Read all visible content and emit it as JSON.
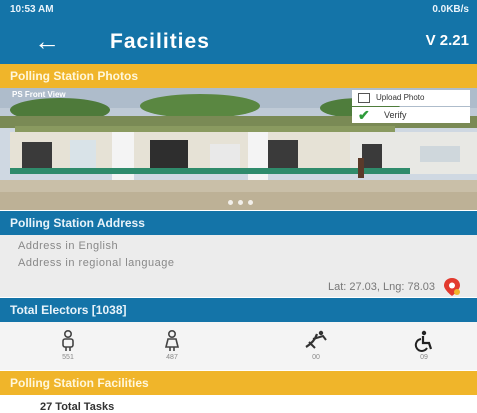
{
  "status_bar": {
    "time": "10:53 AM",
    "right_text": "0.0KB/s"
  },
  "app_bar": {
    "title": "Facilities",
    "version": "V 2.21"
  },
  "photos_section": {
    "header": "Polling Station Photos",
    "photo_label": "PS Front View",
    "upload_label": "Upload Photo",
    "verify_label": "Verify"
  },
  "address_section": {
    "header": "Polling Station Address",
    "address_english": "Address in English",
    "address_regional": "Address in regional language",
    "latlng": "Lat: 27.03, Lng: 78.03"
  },
  "electors_section": {
    "header": "Total Electors [1038]",
    "items": [
      {
        "icon": "male-voter-icon",
        "count": "551"
      },
      {
        "icon": "female-voter-icon",
        "count": "487"
      },
      {
        "icon": "third-gender-icon",
        "count": "00"
      },
      {
        "icon": "wheelchair-icon",
        "count": "09"
      }
    ]
  },
  "facilities_section": {
    "header": "Polling Station Facilities",
    "partial_text": "27 Total Tasks"
  },
  "colors": {
    "primary": "#1474a8",
    "accent": "#f0b52a"
  }
}
